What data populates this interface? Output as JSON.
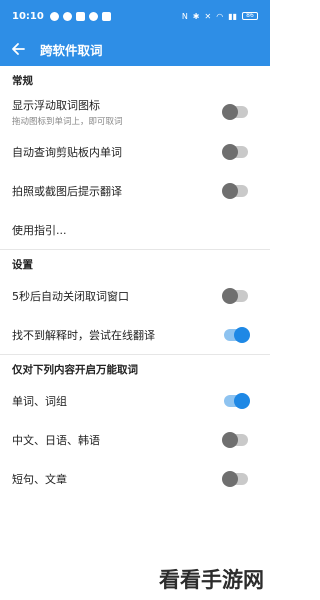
{
  "status_bar": {
    "time": "10:10",
    "battery": "86"
  },
  "app_bar": {
    "title": "跨软件取词"
  },
  "sections": {
    "general": {
      "title": "常规",
      "show_icon": {
        "label": "显示浮动取词图标",
        "sub": "拖动图标到单词上，即可取词",
        "on": false
      },
      "clipboard": {
        "label": "自动查询剪贴板内单词",
        "on": false
      },
      "photo": {
        "label": "拍照或截图后提示翻译",
        "on": false
      },
      "guide": {
        "label": "使用指引..."
      }
    },
    "settings": {
      "title": "设置",
      "auto_close": {
        "label": "5秒后自动关闭取词窗口",
        "on": false
      },
      "online": {
        "label": "找不到解释时，尝试在线翻译",
        "on": true
      }
    },
    "universal": {
      "title": "仅对下列内容开启万能取词",
      "words": {
        "label": "单词、词组",
        "on": true
      },
      "cjk": {
        "label": "中文、日语、韩语",
        "on": false
      },
      "sentences": {
        "label": "短句、文章",
        "on": false
      }
    }
  },
  "watermark": "看看手游网",
  "colors": {
    "accent": "#2e8ee6",
    "toggle_on": "#1e88e5",
    "toggle_off": "#6f6f6f"
  }
}
